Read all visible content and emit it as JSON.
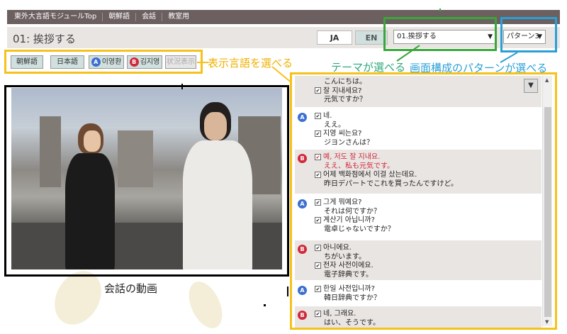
{
  "topnav": {
    "items": [
      "東外大言語モジュールTop",
      "朝鮮語",
      "会話",
      "教室用"
    ]
  },
  "header": {
    "title": "01: 挨拶する",
    "lang_ja": "JA",
    "lang_en": "EN",
    "theme_select": "01.挨拶する",
    "pattern_select": "パターン3"
  },
  "display_buttons": {
    "korean": "朝鮮語",
    "japanese": "日本語",
    "speaker_a_badge": "A",
    "speaker_a": "이영환",
    "speaker_b_badge": "B",
    "speaker_b": "김지영",
    "status": "状況表示"
  },
  "annotations": {
    "display_language": "表示言語を選べる",
    "theme": "テーマが選べる",
    "pattern": "画面構成のパターンが選べる",
    "video": "会話の動画"
  },
  "dialog": [
    {
      "speaker": "",
      "lines": [
        {
          "text": "こんにちは。",
          "check": false,
          "red": false,
          "jp": true
        },
        {
          "text": "잘 지내세요?",
          "check": true,
          "red": false,
          "jp": false
        },
        {
          "text": "元気ですか？",
          "check": false,
          "red": false,
          "jp": true
        }
      ]
    },
    {
      "speaker": "A",
      "lines": [
        {
          "text": "네.",
          "check": true,
          "red": false,
          "jp": false
        },
        {
          "text": "ええ。",
          "check": false,
          "red": false,
          "jp": true
        },
        {
          "text": "지영 씨는요?",
          "check": true,
          "red": false,
          "jp": false
        },
        {
          "text": "ジヨンさんは？",
          "check": false,
          "red": false,
          "jp": true
        }
      ]
    },
    {
      "speaker": "B",
      "lines": [
        {
          "text": "예, 저도 잘 지내요.",
          "check": true,
          "red": true,
          "jp": false
        },
        {
          "text": "ええ、私も元気です。",
          "check": false,
          "red": true,
          "jp": true
        },
        {
          "text": "어제 백화점에서 이걸 샀는데요.",
          "check": true,
          "red": false,
          "jp": false
        },
        {
          "text": "昨日デパートでこれを買ったんですけど。",
          "check": false,
          "red": false,
          "jp": true
        }
      ]
    },
    {
      "speaker": "A",
      "lines": [
        {
          "text": "그게 뭐예요?",
          "check": true,
          "red": false,
          "jp": false
        },
        {
          "text": "それは何ですか？",
          "check": false,
          "red": false,
          "jp": true
        },
        {
          "text": "계산기 아닙니까?",
          "check": true,
          "red": false,
          "jp": false
        },
        {
          "text": "電卓じゃないですか？",
          "check": false,
          "red": false,
          "jp": true
        }
      ]
    },
    {
      "speaker": "B",
      "lines": [
        {
          "text": "아니에요.",
          "check": true,
          "red": false,
          "jp": false
        },
        {
          "text": "ちがいます。",
          "check": false,
          "red": false,
          "jp": true
        },
        {
          "text": "전자 사전이에요.",
          "check": true,
          "red": false,
          "jp": false
        },
        {
          "text": "電子辞典です。",
          "check": false,
          "red": false,
          "jp": true
        }
      ]
    },
    {
      "speaker": "A",
      "lines": [
        {
          "text": "한일 사전입니까?",
          "check": true,
          "red": false,
          "jp": false
        },
        {
          "text": "韓日辞典ですか？",
          "check": false,
          "red": false,
          "jp": true
        }
      ]
    },
    {
      "speaker": "B",
      "lines": [
        {
          "text": "네, 그래요.",
          "check": true,
          "red": false,
          "jp": false
        },
        {
          "text": "はい、そうです。",
          "check": false,
          "red": false,
          "jp": true
        }
      ]
    }
  ],
  "colors": {
    "nav_bg": "#6b5f5f",
    "highlight_yellow": "#f5c21b",
    "highlight_green": "#3aa63a",
    "highlight_blue": "#2a9fd8",
    "speaker_a": "#3b6fd0",
    "speaker_b": "#d02a3a"
  }
}
